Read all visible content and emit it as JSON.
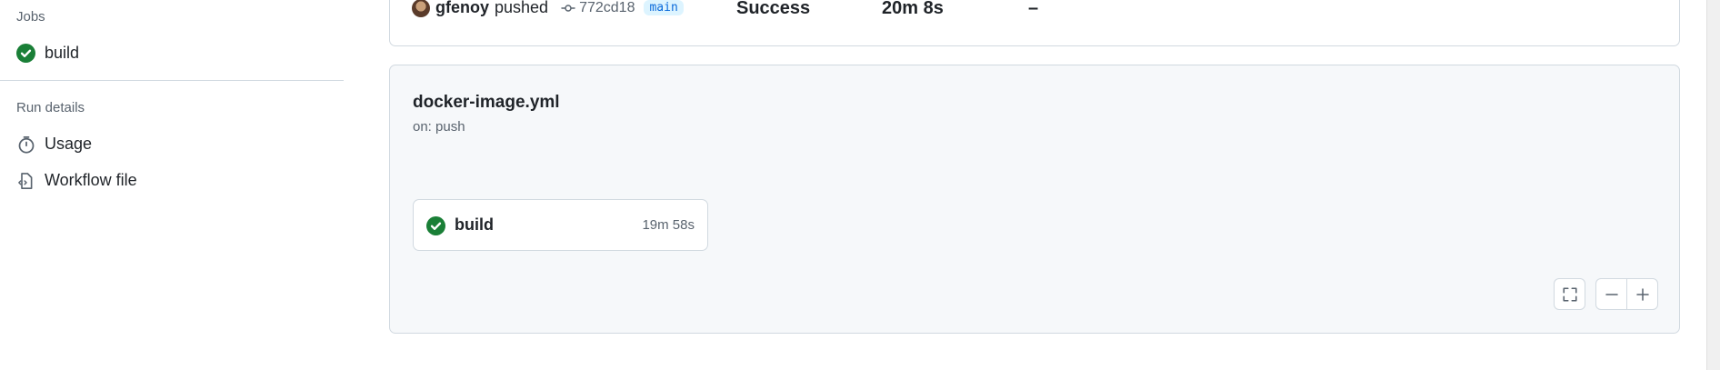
{
  "sidebar": {
    "jobs_title": "Jobs",
    "jobs": [
      {
        "label": "build",
        "status": "success",
        "icon": "check-circle-icon"
      }
    ],
    "run_details_title": "Run details",
    "run_details": [
      {
        "label": "Usage",
        "icon": "stopwatch-icon"
      },
      {
        "label": "Workflow file",
        "icon": "file-code-icon"
      }
    ]
  },
  "summary": {
    "actor": "gfenoy",
    "action": "pushed",
    "commit": "772cd18",
    "branch": "main",
    "status": "Success",
    "duration": "20m 8s",
    "artifacts": "–"
  },
  "workflow": {
    "name": "docker-image.yml",
    "trigger": "on: push",
    "jobs": [
      {
        "name": "build",
        "duration": "19m 58s",
        "status": "success"
      }
    ]
  },
  "colors": {
    "success": "#1a7f37",
    "border": "#d1d9e0",
    "muted": "#59636e",
    "canvas": "#f6f8fa",
    "branch_bg": "#ddf4ff",
    "branch_fg": "#0969da"
  }
}
